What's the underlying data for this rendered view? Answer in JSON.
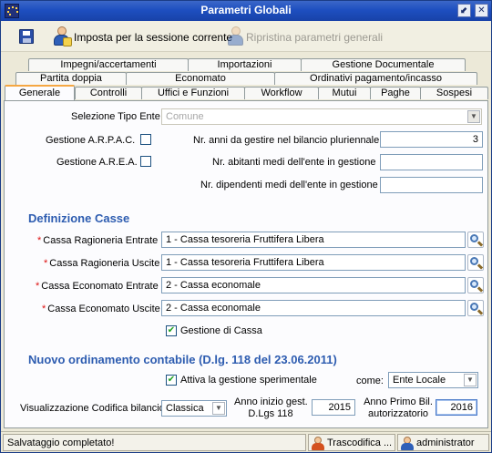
{
  "window": {
    "title": "Parametri Globali"
  },
  "toolbar": {
    "apply_session_label": "Imposta per la sessione corrente",
    "restore_label": "Ripristina parametri generali"
  },
  "tabs": {
    "row1": [
      "Impegni/accertamenti",
      "Importazioni",
      "Gestione Documentale"
    ],
    "row2": [
      "Partita doppia",
      "Economato",
      "Ordinativi pagamento/incasso"
    ],
    "row3": [
      "Generale",
      "Controlli",
      "Uffici e Funzioni",
      "Workflow",
      "Mutui",
      "Paghe",
      "Sospesi"
    ],
    "active": "Generale"
  },
  "general": {
    "tipo_ente_label": "Selezione Tipo Ente",
    "tipo_ente_value": "Comune",
    "arpac_label": "Gestione A.R.P.A.C.",
    "arpac_checked": false,
    "area_label": "Gestione A.R.E.A.",
    "area_checked": false,
    "anni_label": "Nr. anni da gestire nel bilancio pluriennale",
    "anni_value": "3",
    "abitanti_label": "Nr. abitanti medi dell'ente in gestione",
    "abitanti_value": "",
    "dipendenti_label": "Nr. dipendenti medi dell'ente in gestione",
    "dipendenti_value": ""
  },
  "casse": {
    "section_title": "Definizione Casse",
    "required_mark": "*",
    "rag_entrate_label": "Cassa Ragioneria Entrate",
    "rag_entrate_value": "1 - Cassa tesoreria Fruttifera Libera",
    "rag_uscite_label": "Cassa Ragioneria Uscite",
    "rag_uscite_value": "1 - Cassa tesoreria Fruttifera Libera",
    "eco_entrate_label": "Cassa Economato Entrate",
    "eco_entrate_value": "2 - Cassa economale",
    "eco_uscite_label": "Cassa Economato Uscite",
    "eco_uscite_value": "2 - Cassa economale",
    "gestione_cassa_label": "Gestione di Cassa",
    "gestione_cassa_checked": true
  },
  "ordinamento": {
    "section_title": "Nuovo ordinamento contabile (D.lg. 118 del 23.06.2011)",
    "sperimentale_label": "Attiva la gestione sperimentale",
    "sperimentale_checked": true,
    "come_label": "come:",
    "come_value": "Ente Locale",
    "codifica_label": "Visualizzazione Codifica bilancio",
    "codifica_value": "Classica",
    "anno_inizio_label_1": "Anno inizio gest.",
    "anno_inizio_label_2": "D.Lgs 118",
    "anno_inizio_value": "2015",
    "anno_primo_label_1": "Anno Primo Bil.",
    "anno_primo_label_2": "autorizzatorio",
    "anno_primo_value": "2016"
  },
  "statusbar": {
    "message": "Salvataggio completato!",
    "task": "Trascodifica ...",
    "user": "administrator"
  }
}
